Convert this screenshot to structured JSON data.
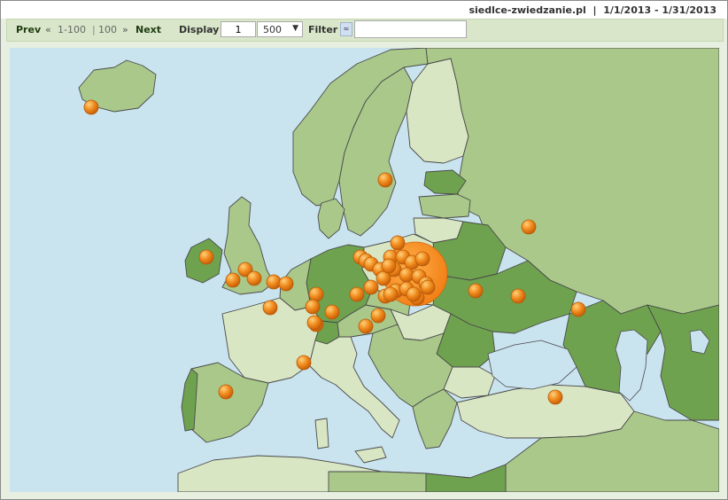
{
  "header": {
    "site": "siedlce-zwiedzanie.pl",
    "separator": "|",
    "date_range": "1/1/2013 - 1/31/2013"
  },
  "toolbar": {
    "prev_label": "Prev",
    "prev_icon": "double-chevron-left-icon",
    "range_first": "1-100",
    "range_separator": "|",
    "range_last": "100",
    "next_icon": "double-chevron-right-icon",
    "next_label": "Next",
    "display_label": "Display",
    "page_value": "1",
    "per_page_value": "500",
    "filter_label": "Filter",
    "filter_icon": "filter-icon",
    "filter_value": ""
  },
  "colors": {
    "sea": "#c9e3ef",
    "land_light": "#d9e6c4",
    "land_mid": "#a9c88a",
    "land_dark": "#6fa24e",
    "marker": "#f08a1c",
    "marker_highlight": "#ffd07a",
    "border": "#4a4a4a"
  },
  "map": {
    "region": "Europe",
    "legend_or_scale": "none",
    "markers_note": "orange circles indicate visitor locations; largest cluster centered on eastern Poland"
  }
}
